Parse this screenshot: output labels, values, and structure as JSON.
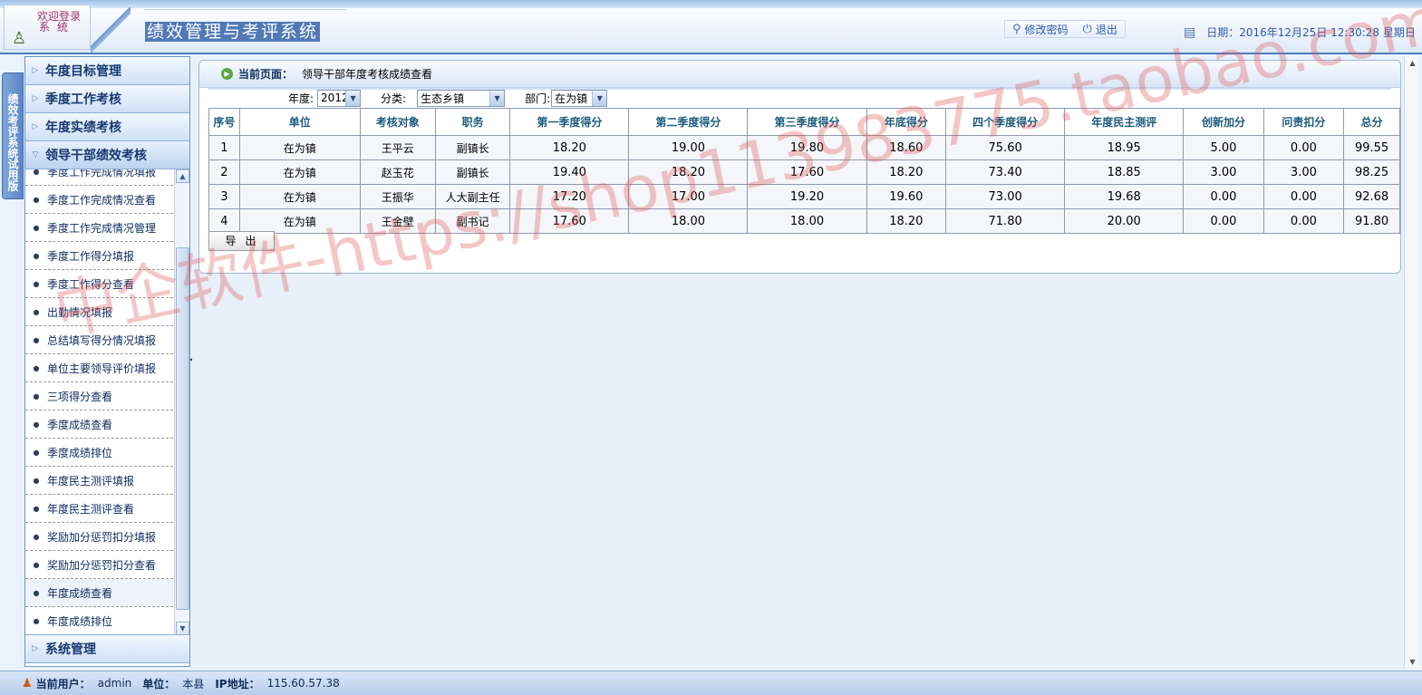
{
  "header": {
    "logo_line1": "欢迎登录",
    "logo_line2": "系统",
    "system_title": "绩效管理与考评系统",
    "buttons": [
      {
        "label": "修改密码",
        "icon": "key-icon"
      },
      {
        "label": "退出",
        "icon": "power-icon"
      }
    ],
    "date_text": "日期：2016年12月25日  12:30:28 星期日"
  },
  "vertical_tab": "绩效考评系统试用版",
  "sidebar": {
    "groups": [
      {
        "label": "年度目标管理"
      },
      {
        "label": "季度工作考核"
      },
      {
        "label": "年度实绩考核"
      },
      {
        "label": "领导干部绩效考核"
      }
    ],
    "items": [
      "季度工作完成情况填报",
      "季度工作完成情况查看",
      "季度工作完成情况管理",
      "季度工作得分填报",
      "季度工作得分查看",
      "出勤情况填报",
      "总结填写得分情况填报",
      "单位主要领导评价填报",
      "三项得分查看",
      "季度成绩查看",
      "季度成绩排位",
      "年度民主测评填报",
      "年度民主测评查看",
      "奖励加分惩罚扣分填报",
      "奖励加分惩罚扣分查看",
      "年度成绩查看",
      "年度成绩排位"
    ],
    "active_item": "年度成绩查看",
    "bottom_group": "系统管理"
  },
  "main": {
    "breadcrumb_label": "当前页面：",
    "breadcrumb_value": "领导干部年度考核成绩查看",
    "filters": {
      "year_label": "年度:",
      "year_value": "2012",
      "category_label": "分类:",
      "category_value": "生态乡镇",
      "dept_label": "部门:",
      "dept_value": "在为镇"
    },
    "columns": [
      "序号",
      "单位",
      "考核对象",
      "职务",
      "第一季度得分",
      "第二季度得分",
      "第三季度得分",
      "年底得分",
      "四个季度得分",
      "年度民主测评",
      "创新加分",
      "问责扣分",
      "总分"
    ],
    "rows": [
      [
        "1",
        "在为镇",
        "王平云",
        "副镇长",
        "18.20",
        "19.00",
        "19.80",
        "18.60",
        "75.60",
        "18.95",
        "5.00",
        "0.00",
        "99.55"
      ],
      [
        "2",
        "在为镇",
        "赵玉花",
        "副镇长",
        "19.40",
        "18.20",
        "17.60",
        "18.20",
        "73.40",
        "18.85",
        "3.00",
        "3.00",
        "98.25"
      ],
      [
        "3",
        "在为镇",
        "王振华",
        "人大副主任",
        "17.20",
        "17.00",
        "19.20",
        "19.60",
        "73.00",
        "19.68",
        "0.00",
        "0.00",
        "92.68"
      ],
      [
        "4",
        "在为镇",
        "王金壁",
        "副书记",
        "17.60",
        "18.00",
        "18.00",
        "18.20",
        "71.80",
        "20.00",
        "0.00",
        "0.00",
        "91.80"
      ]
    ],
    "export_label": "导出"
  },
  "watermark": "中企软件-https://shop113983775.taobao.com",
  "footer": {
    "user_label": "当前用户：",
    "user_value": "admin",
    "unit_label": "单位：",
    "unit_value": "本县",
    "ip_label": "IP地址：",
    "ip_value": "115.60.57.38"
  }
}
